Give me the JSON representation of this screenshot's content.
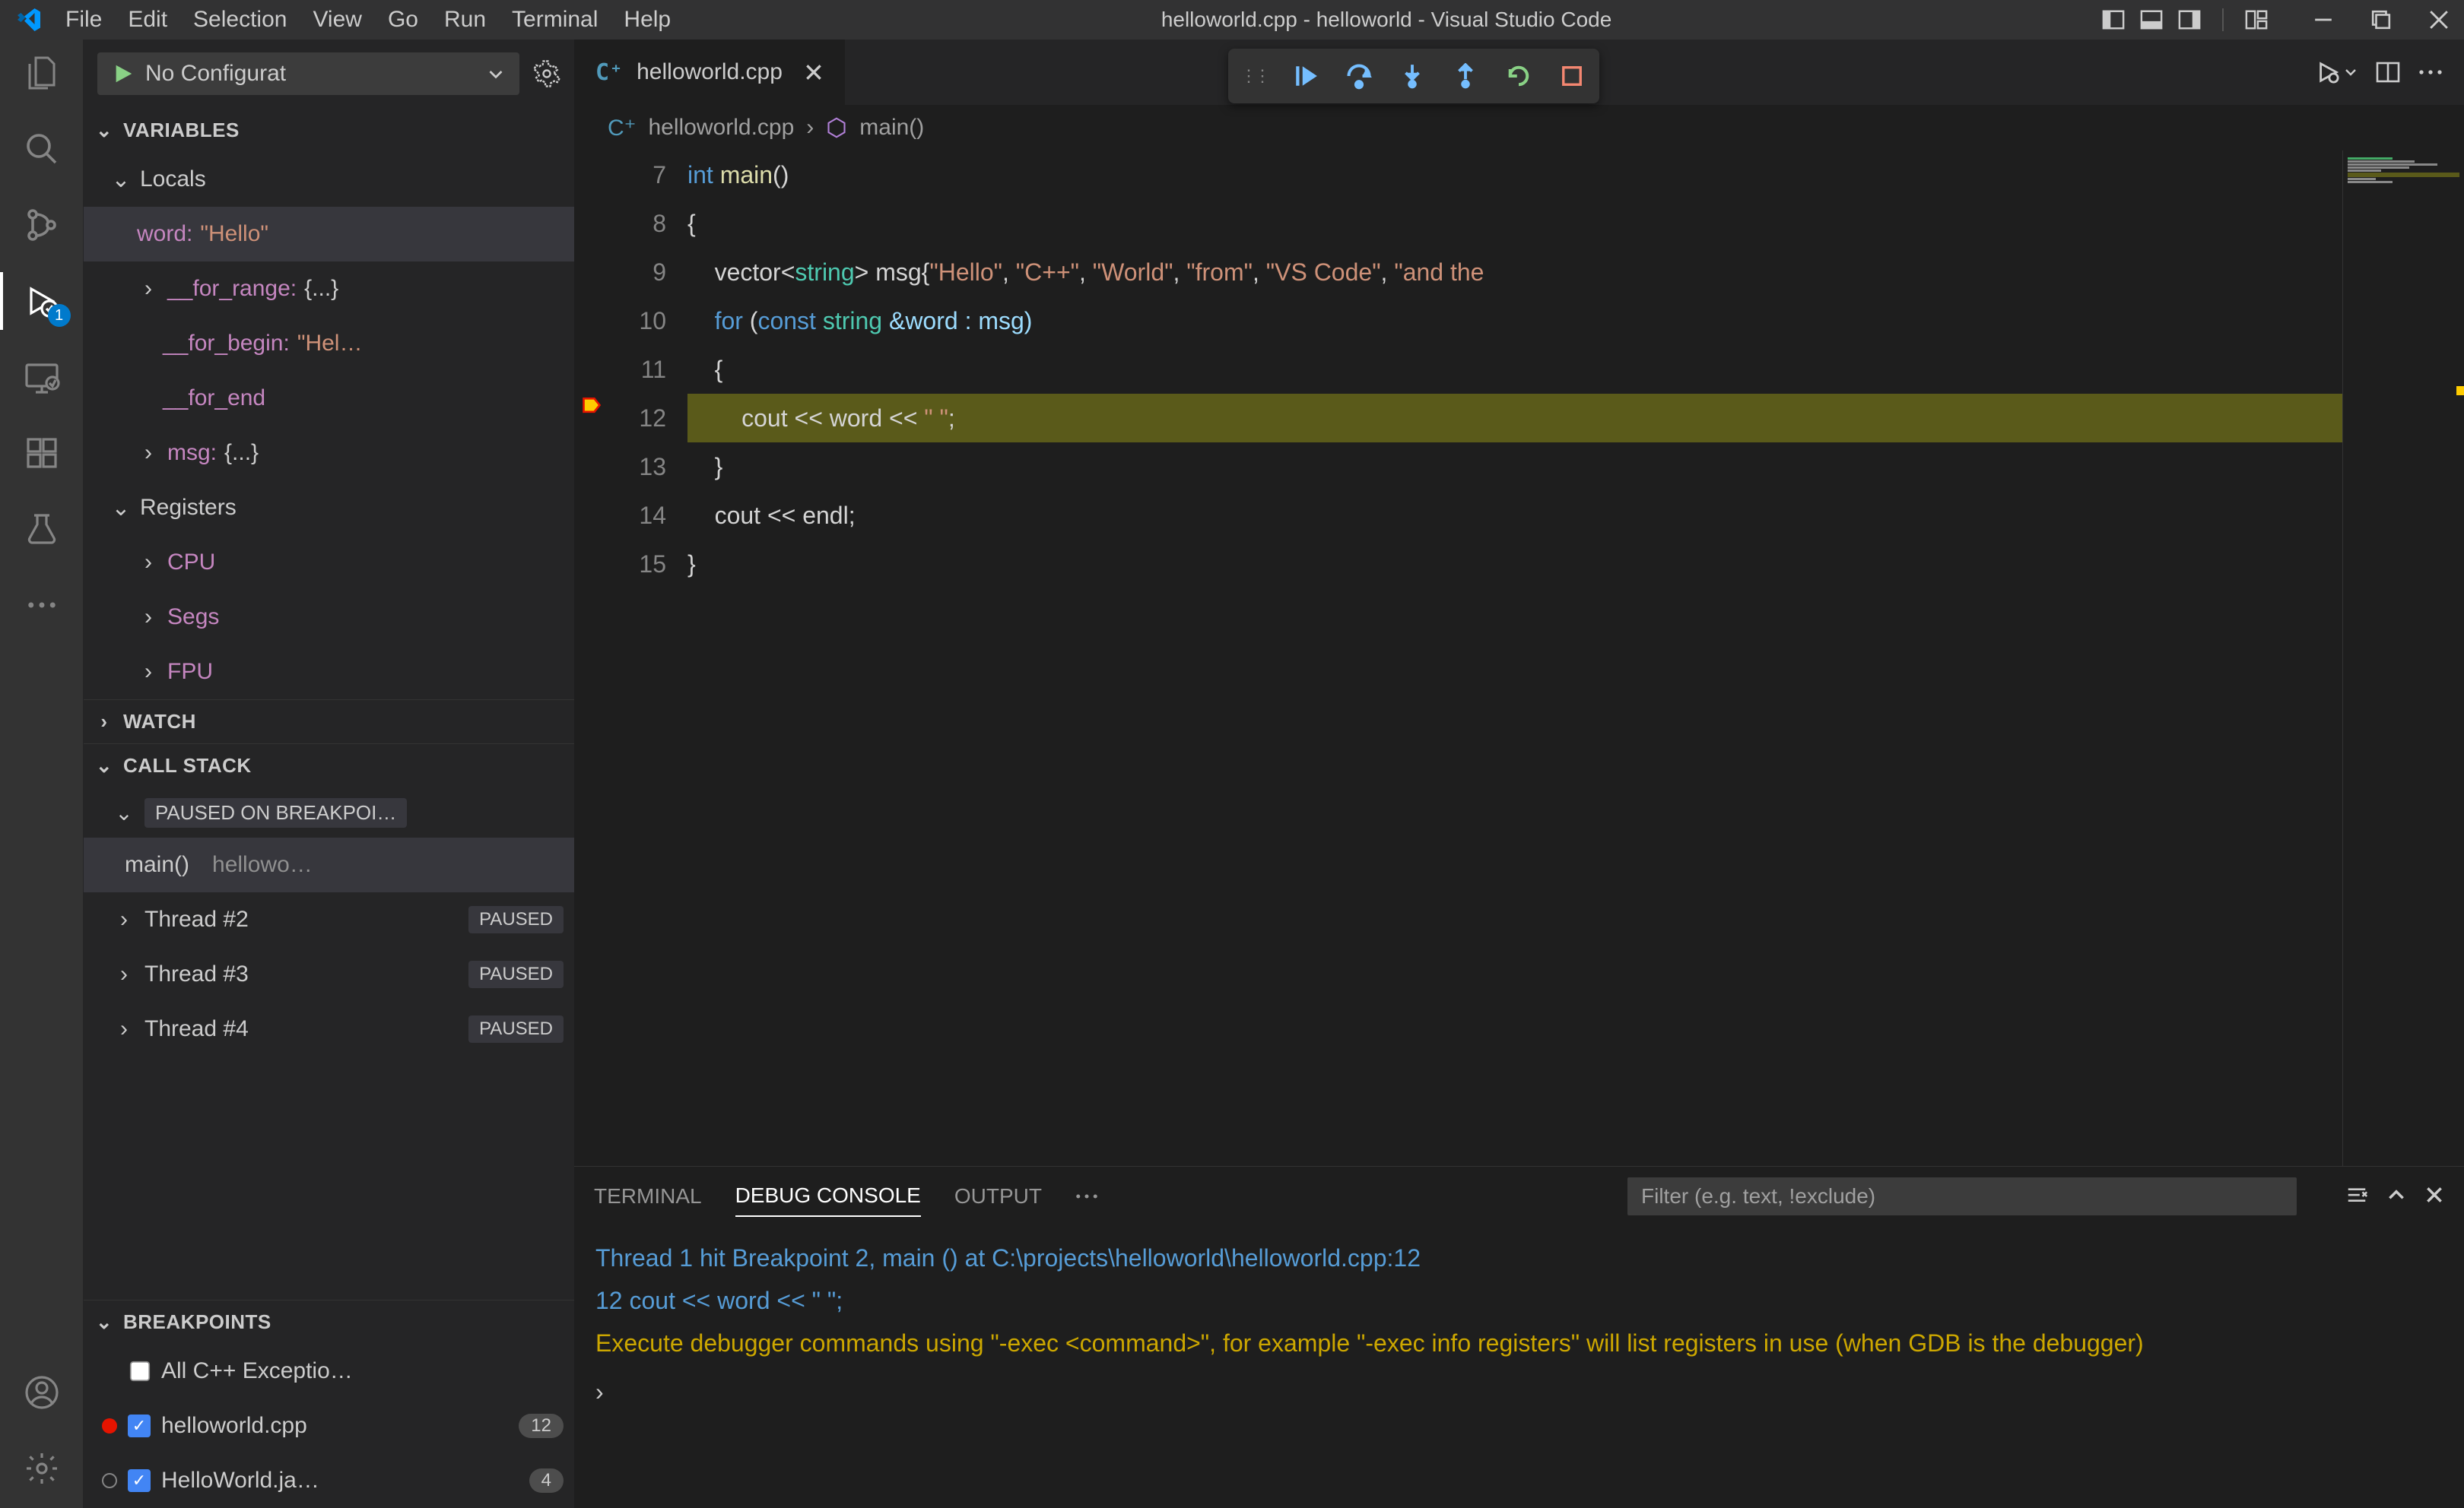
{
  "titlebar": {
    "menu": [
      "File",
      "Edit",
      "Selection",
      "View",
      "Go",
      "Run",
      "Terminal",
      "Help"
    ],
    "title": "helloworld.cpp - helloworld - Visual Studio Code"
  },
  "activitybar": {
    "debug_badge": "1"
  },
  "sidebar": {
    "config": "No Configurat",
    "sections": {
      "variables": "VARIABLES",
      "locals": "Locals",
      "registers": "Registers",
      "watch": "WATCH",
      "callstack": "CALL STACK",
      "breakpoints": "BREAKPOINTS"
    },
    "vars": {
      "word_name": "word: ",
      "word_val": "\"Hello\"",
      "for_range": "__for_range: ",
      "for_range_val": "{...}",
      "for_begin": "__for_begin: ",
      "for_begin_val": "\"Hel…",
      "for_end": "__for_end",
      "msg": "msg: ",
      "msg_val": "{...}"
    },
    "regs": {
      "cpu": "CPU",
      "segs": "Segs",
      "fpu": "FPU"
    },
    "callstack": {
      "paused_label": "PAUSED ON BREAKPOI…",
      "frame_func": "main()",
      "frame_file": "hellowo…",
      "threads": [
        "Thread #2",
        "Thread #3",
        "Thread #4"
      ],
      "thread_status": "PAUSED"
    },
    "breakpoints": {
      "all_exc": "All C++ Exceptio…",
      "bp1": "helloworld.cpp",
      "bp1_count": "12",
      "bp2": "HelloWorld.ja…",
      "bp2_count": "4"
    }
  },
  "tabs": {
    "file": "helloworld.cpp"
  },
  "breadcrumb": {
    "file": "helloworld.cpp",
    "symbol": "main()"
  },
  "code": {
    "lines": [
      "7",
      "8",
      "9",
      "10",
      "11",
      "12",
      "13",
      "14",
      "15"
    ],
    "l7_kw": "int ",
    "l7_fn": "main",
    "l7_rest": "()",
    "l8": "{",
    "l9_a": "    vector",
    "l9_b": "<",
    "l9_c": "string",
    "l9_d": "> msg{",
    "l9_s1": "\"Hello\"",
    "l9_cm": ", ",
    "l9_s2": "\"C++\"",
    "l9_s3": "\"World\"",
    "l9_s4": "\"from\"",
    "l9_s5": "\"VS Code\"",
    "l9_s6": "\"and the",
    "l10_a": "    for ",
    "l10_b": "(",
    "l10_c": "const ",
    "l10_d": "string ",
    "l10_e": "&word : msg)",
    "l11": "    {",
    "l12_a": "        cout << word << ",
    "l12_s": "\" \"",
    "l12_b": ";",
    "l13": "    }",
    "l14": "    cout << endl;",
    "l15": "}"
  },
  "panel": {
    "tabs": {
      "terminal": "TERMINAL",
      "console": "DEBUG CONSOLE",
      "output": "OUTPUT"
    },
    "filter_placeholder": "Filter (e.g. text, !exclude)",
    "line1": "Thread 1 hit Breakpoint 2, main () at C:\\projects\\helloworld\\helloworld.cpp:12",
    "line2a": "12",
    "line2b": "            cout << word << \" \";",
    "line3": "Execute debugger commands using \"-exec <command>\", for example \"-exec info registers\" will list registers in use (when GDB is the debugger)",
    "prompt": "›"
  }
}
